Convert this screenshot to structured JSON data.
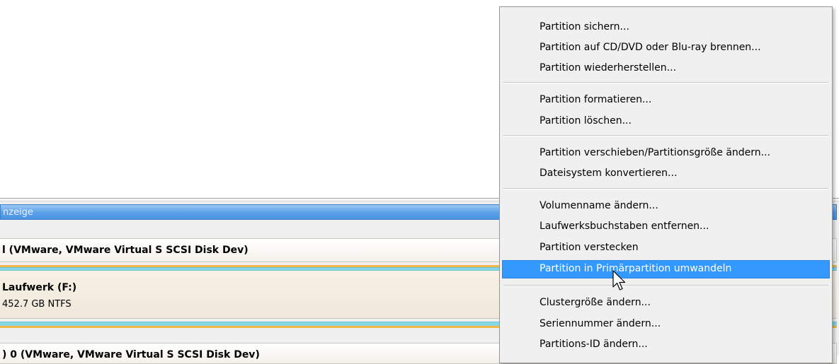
{
  "background": {
    "display_header_label": "nzeige",
    "disk_1_title": "l (VMware, VMware Virtual S SCSI Disk Dev)",
    "partition_name": "Laufwerk (F:)",
    "partition_info": "452.7 GB NTFS",
    "disk_2_title": ") 0 (VMware, VMware Virtual S SCSI Disk Dev)"
  },
  "context_menu": {
    "items": [
      {
        "label": "Partition sichern..."
      },
      {
        "label": "Partition auf CD/DVD oder Blu-ray brennen..."
      },
      {
        "label": "Partition wiederherstellen..."
      },
      {
        "label": "Partition formatieren..."
      },
      {
        "label": "Partition löschen..."
      },
      {
        "label": "Partition verschieben/Partitionsgröße ändern..."
      },
      {
        "label": "Dateisystem konvertieren..."
      },
      {
        "label": "Volumenname ändern..."
      },
      {
        "label": "Laufwerksbuchstaben entfernen..."
      },
      {
        "label": "Partition verstecken"
      },
      {
        "label": "Partition in Primärpartition umwandeln",
        "highlighted": true
      },
      {
        "label": "Clustergröße ändern..."
      },
      {
        "label": "Seriennummer ändern..."
      },
      {
        "label": "Partitions-ID ändern..."
      }
    ]
  },
  "colors": {
    "highlight": "#3399ff",
    "header_blue": "#5a9fe8",
    "stripe_orange": "#f3b74a",
    "stripe_teal": "#87d8e6"
  },
  "cursor": "arrow-pointer-icon"
}
